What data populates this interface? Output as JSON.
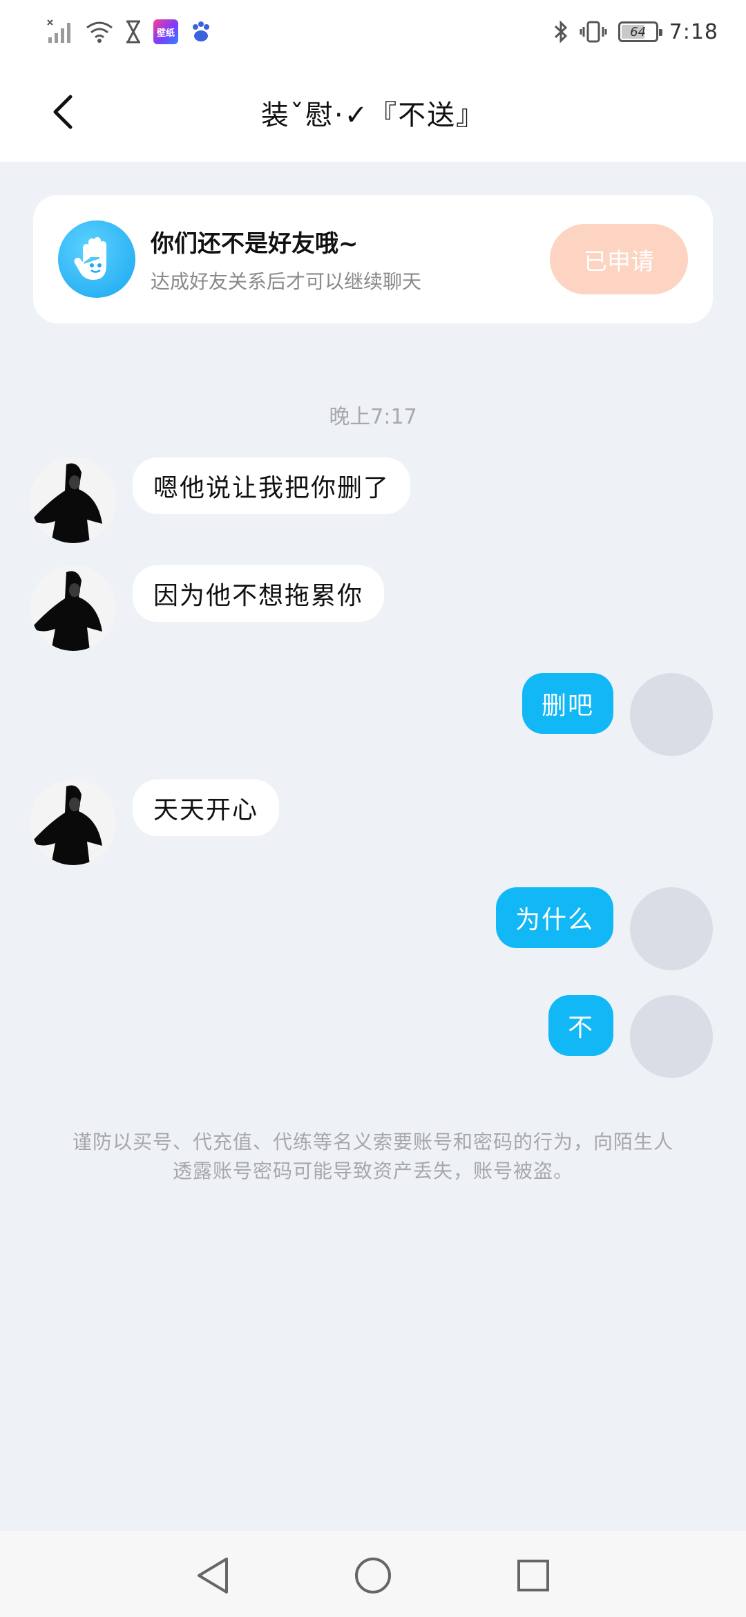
{
  "status_bar": {
    "app_badge": "壁纸",
    "battery_level": "64",
    "time": "7:18"
  },
  "header": {
    "title": "装ˇ慰·✓『不送』"
  },
  "friend_notice": {
    "title": "你们还不是好友哦~",
    "subtitle": "达成好友关系后才可以继续聊天",
    "button_label": "已申请"
  },
  "chat": {
    "timestamp": "晚上7:17",
    "messages": [
      {
        "side": "left",
        "text": "嗯他说让我把你删了"
      },
      {
        "side": "left",
        "text": "因为他不想拖累你"
      },
      {
        "side": "right",
        "text": "删吧"
      },
      {
        "side": "left",
        "text": "天天开心"
      },
      {
        "side": "right",
        "text": "为什么"
      },
      {
        "side": "right",
        "text": "不"
      }
    ]
  },
  "warning": "谨防以买号、代充值、代练等名义索要账号和密码的行为，向陌生人透露账号密码可能导致资产丢失，账号被盗。",
  "colors": {
    "background": "#eef2f7",
    "outgoing_bubble": "#12b7f5",
    "applied_button": "#fdd3c1"
  }
}
